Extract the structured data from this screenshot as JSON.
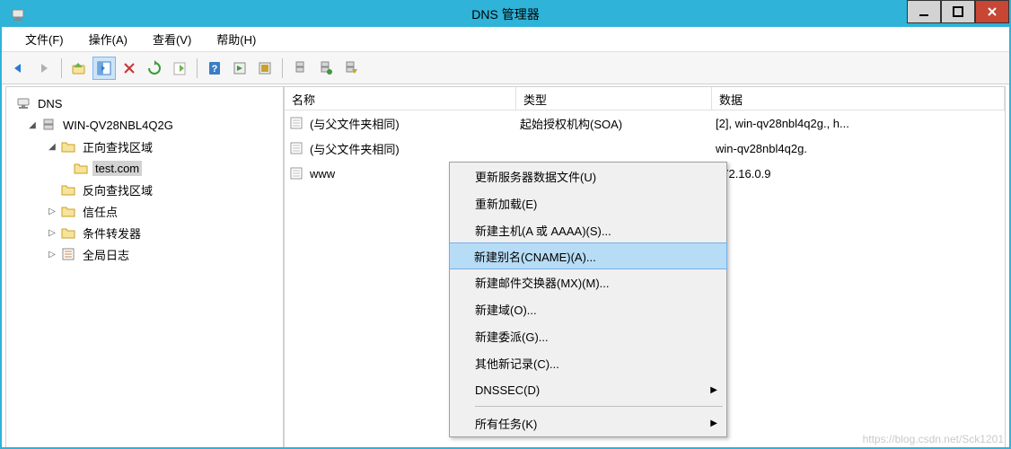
{
  "window": {
    "title": "DNS 管理器"
  },
  "menubar": [
    "文件(F)",
    "操作(A)",
    "查看(V)",
    "帮助(H)"
  ],
  "tree": {
    "root": "DNS",
    "server": "WIN-QV28NBL4Q2G",
    "forward_zone_folder": "正向查找区域",
    "selected_zone": "test.com",
    "reverse_zone_folder": "反向查找区域",
    "trust_points": "信任点",
    "conditional_forwarders": "条件转发器",
    "global_logs": "全局日志"
  },
  "list": {
    "headers": {
      "name": "名称",
      "type": "类型",
      "data": "数据"
    },
    "rows": [
      {
        "name": "(与父文件夹相同)",
        "type": "起始授权机构(SOA)",
        "data": "[2], win-qv28nbl4q2g., h..."
      },
      {
        "name": "(与父文件夹相同)",
        "type": "",
        "data": "win-qv28nbl4q2g."
      },
      {
        "name": "www",
        "type": "",
        "data": "172.16.0.9"
      }
    ]
  },
  "context_menu": {
    "items": [
      {
        "label": "更新服务器数据文件(U)",
        "highlighted": false
      },
      {
        "label": "重新加载(E)",
        "highlighted": false
      },
      {
        "label": "新建主机(A 或 AAAA)(S)...",
        "highlighted": false
      },
      {
        "label": "新建别名(CNAME)(A)...",
        "highlighted": true
      },
      {
        "label": "新建邮件交换器(MX)(M)...",
        "highlighted": false
      },
      {
        "label": "新建域(O)...",
        "highlighted": false
      },
      {
        "label": "新建委派(G)...",
        "highlighted": false
      },
      {
        "label": "其他新记录(C)...",
        "highlighted": false
      },
      {
        "label": "DNSSEC(D)",
        "highlighted": false,
        "submenu": true
      },
      {
        "sep": true
      },
      {
        "label": "所有任务(K)",
        "highlighted": false,
        "submenu": true
      }
    ]
  },
  "watermark": "https://blog.csdn.net/Sck1201"
}
